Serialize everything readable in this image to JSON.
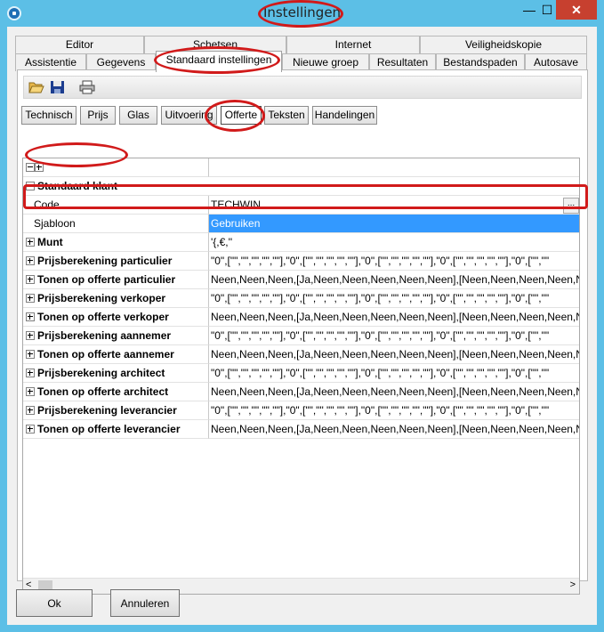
{
  "window": {
    "title": "Instellingen",
    "minimize": "—",
    "maximize": "☐",
    "close": "✕"
  },
  "tabs_row1": [
    "Editor",
    "Schetsen",
    "Internet",
    "Veiligheidskopie"
  ],
  "tabs_row2": [
    "Assistentie",
    "Gegevens",
    "Standaard instellingen",
    "Nieuwe groep",
    "Resultaten",
    "Bestandspaden",
    "Autosave"
  ],
  "subtabs": [
    "Technisch",
    "Prijs",
    "Glas",
    "Uitvoering",
    "Offerte",
    "Teksten",
    "Handelingen"
  ],
  "grid": {
    "group_header": "Standaard klant",
    "rows": [
      {
        "name": "Code",
        "value": "TECHWIN",
        "ellipsis": "..."
      },
      {
        "name": "Sjabloon",
        "value": "Gebruiken"
      },
      {
        "name": "Munt",
        "value": "'{,€,''"
      },
      {
        "name": "Prijsberekening particulier",
        "value": "\"0\",[\"\",\"\",\"\",\"\",\"\"],\"0\",[\"\",\"\",\"\",\"\",\"\"],\"0\",[\"\",\"\",\"\",\"\",\"\"],\"0\",[\"\",\"\",\"\",\"\",\"\"],\"0\",[\"\",\"\""
      },
      {
        "name": "Tonen op offerte particulier",
        "value": "Neen,Neen,Neen,[Ja,Neen,Neen,Neen,Neen,Neen],[Neen,Neen,Neen,Neen,Ne"
      },
      {
        "name": "Prijsberekening verkoper",
        "value": "\"0\",[\"\",\"\",\"\",\"\",\"\"],\"0\",[\"\",\"\",\"\",\"\",\"\"],\"0\",[\"\",\"\",\"\",\"\",\"\"],\"0\",[\"\",\"\",\"\",\"\",\"\"],\"0\",[\"\",\"\""
      },
      {
        "name": "Tonen op offerte verkoper",
        "value": "Neen,Neen,Neen,[Ja,Neen,Neen,Neen,Neen,Neen],[Neen,Neen,Neen,Neen,Ne"
      },
      {
        "name": "Prijsberekening aannemer",
        "value": "\"0\",[\"\",\"\",\"\",\"\",\"\"],\"0\",[\"\",\"\",\"\",\"\",\"\"],\"0\",[\"\",\"\",\"\",\"\",\"\"],\"0\",[\"\",\"\",\"\",\"\",\"\"],\"0\",[\"\",\"\""
      },
      {
        "name": "Tonen op offerte aannemer",
        "value": "Neen,Neen,Neen,[Ja,Neen,Neen,Neen,Neen,Neen],[Neen,Neen,Neen,Neen,Ne"
      },
      {
        "name": "Prijsberekening architect",
        "value": "\"0\",[\"\",\"\",\"\",\"\",\"\"],\"0\",[\"\",\"\",\"\",\"\",\"\"],\"0\",[\"\",\"\",\"\",\"\",\"\"],\"0\",[\"\",\"\",\"\",\"\",\"\"],\"0\",[\"\",\"\""
      },
      {
        "name": "Tonen op offerte architect",
        "value": "Neen,Neen,Neen,[Ja,Neen,Neen,Neen,Neen,Neen],[Neen,Neen,Neen,Neen,Ne"
      },
      {
        "name": "Prijsberekening leverancier",
        "value": "\"0\",[\"\",\"\",\"\",\"\",\"\"],\"0\",[\"\",\"\",\"\",\"\",\"\"],\"0\",[\"\",\"\",\"\",\"\",\"\"],\"0\",[\"\",\"\",\"\",\"\",\"\"],\"0\",[\"\",\"\""
      },
      {
        "name": "Tonen op offerte leverancier",
        "value": "Neen,Neen,Neen,[Ja,Neen,Neen,Neen,Neen,Neen],[Neen,Neen,Neen,Neen,Ne"
      }
    ],
    "scroll_left": "<",
    "scroll_right": ">"
  },
  "buttons": {
    "ok": "Ok",
    "cancel": "Annuleren"
  },
  "colors": {
    "titlebar": "#5cbfe6",
    "selection": "#3399ff",
    "annotation": "#d11a1a"
  }
}
